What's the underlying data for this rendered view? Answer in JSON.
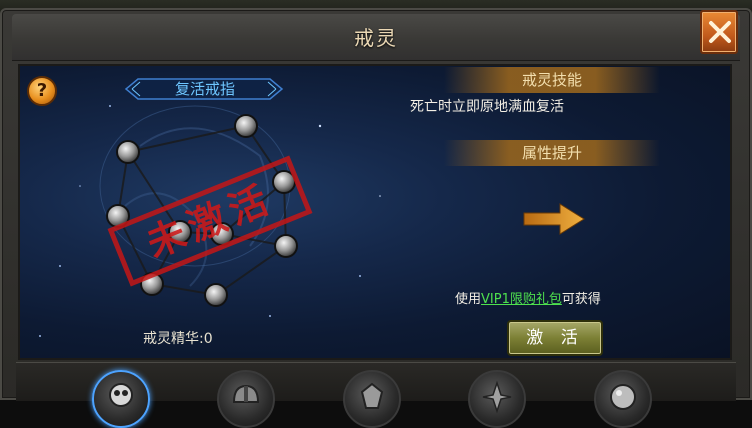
{
  "window": {
    "title": "戒灵"
  },
  "ring": {
    "name": "复活戒指",
    "stamp_text": "未激活",
    "essence_label": "戒灵精华:",
    "essence_value": "0"
  },
  "skill": {
    "header": "戒灵技能",
    "description": "死亡时立即原地满血复活"
  },
  "attributes": {
    "header": "属性提升"
  },
  "obtain": {
    "prefix": "使用",
    "link": "VIP1限购礼包",
    "suffix": "可获得"
  },
  "buttons": {
    "activate": "激 活",
    "help": "?"
  },
  "ring_slots": [
    {
      "icon": "skull-ring-icon",
      "active": true
    },
    {
      "icon": "helmet-ring-icon",
      "active": false
    },
    {
      "icon": "crest-ring-icon",
      "active": false
    },
    {
      "icon": "spike-ring-icon",
      "active": false
    },
    {
      "icon": "orb-ring-icon",
      "active": false
    }
  ],
  "colors": {
    "title_text": "#ecd9b5",
    "ring_name": "#6ec6ff",
    "link": "#4ee04e",
    "stamp": "#c41616",
    "close_button": "#c25a1c"
  }
}
